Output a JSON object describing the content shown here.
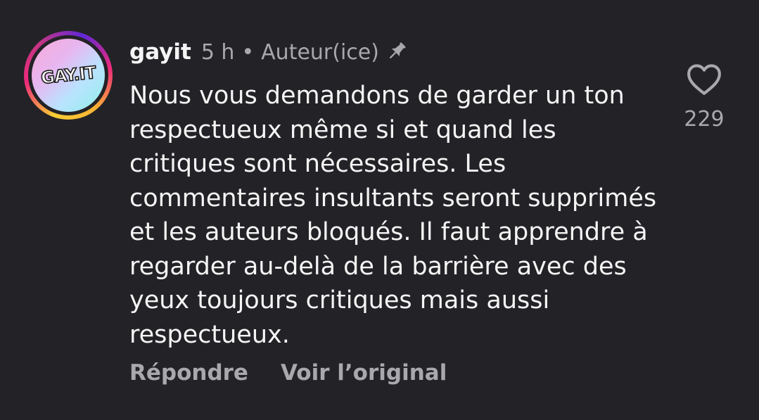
{
  "comment": {
    "avatar": {
      "logo_text": "GAY.IT"
    },
    "username": "gayit",
    "time": "5 h",
    "separator": "•",
    "role": "Auteur(ice)",
    "pin_icon": "pin-icon",
    "text": "Nous vous demandons de garder un ton respectueux même si et quand les critiques sont nécessaires. Les commentaires insultants seront supprimés et les auteurs bloqués. Il faut apprendre à regarder au-delà de la barrière avec des yeux toujours critiques mais aussi respectueux.",
    "actions": {
      "reply_label": "Répondre",
      "see_original_label": "Voir l’original"
    },
    "like": {
      "icon": "heart-icon",
      "count": "229"
    }
  },
  "colors": {
    "background": "#232226",
    "text": "#f5f5f5",
    "muted": "#a8a8ad"
  }
}
